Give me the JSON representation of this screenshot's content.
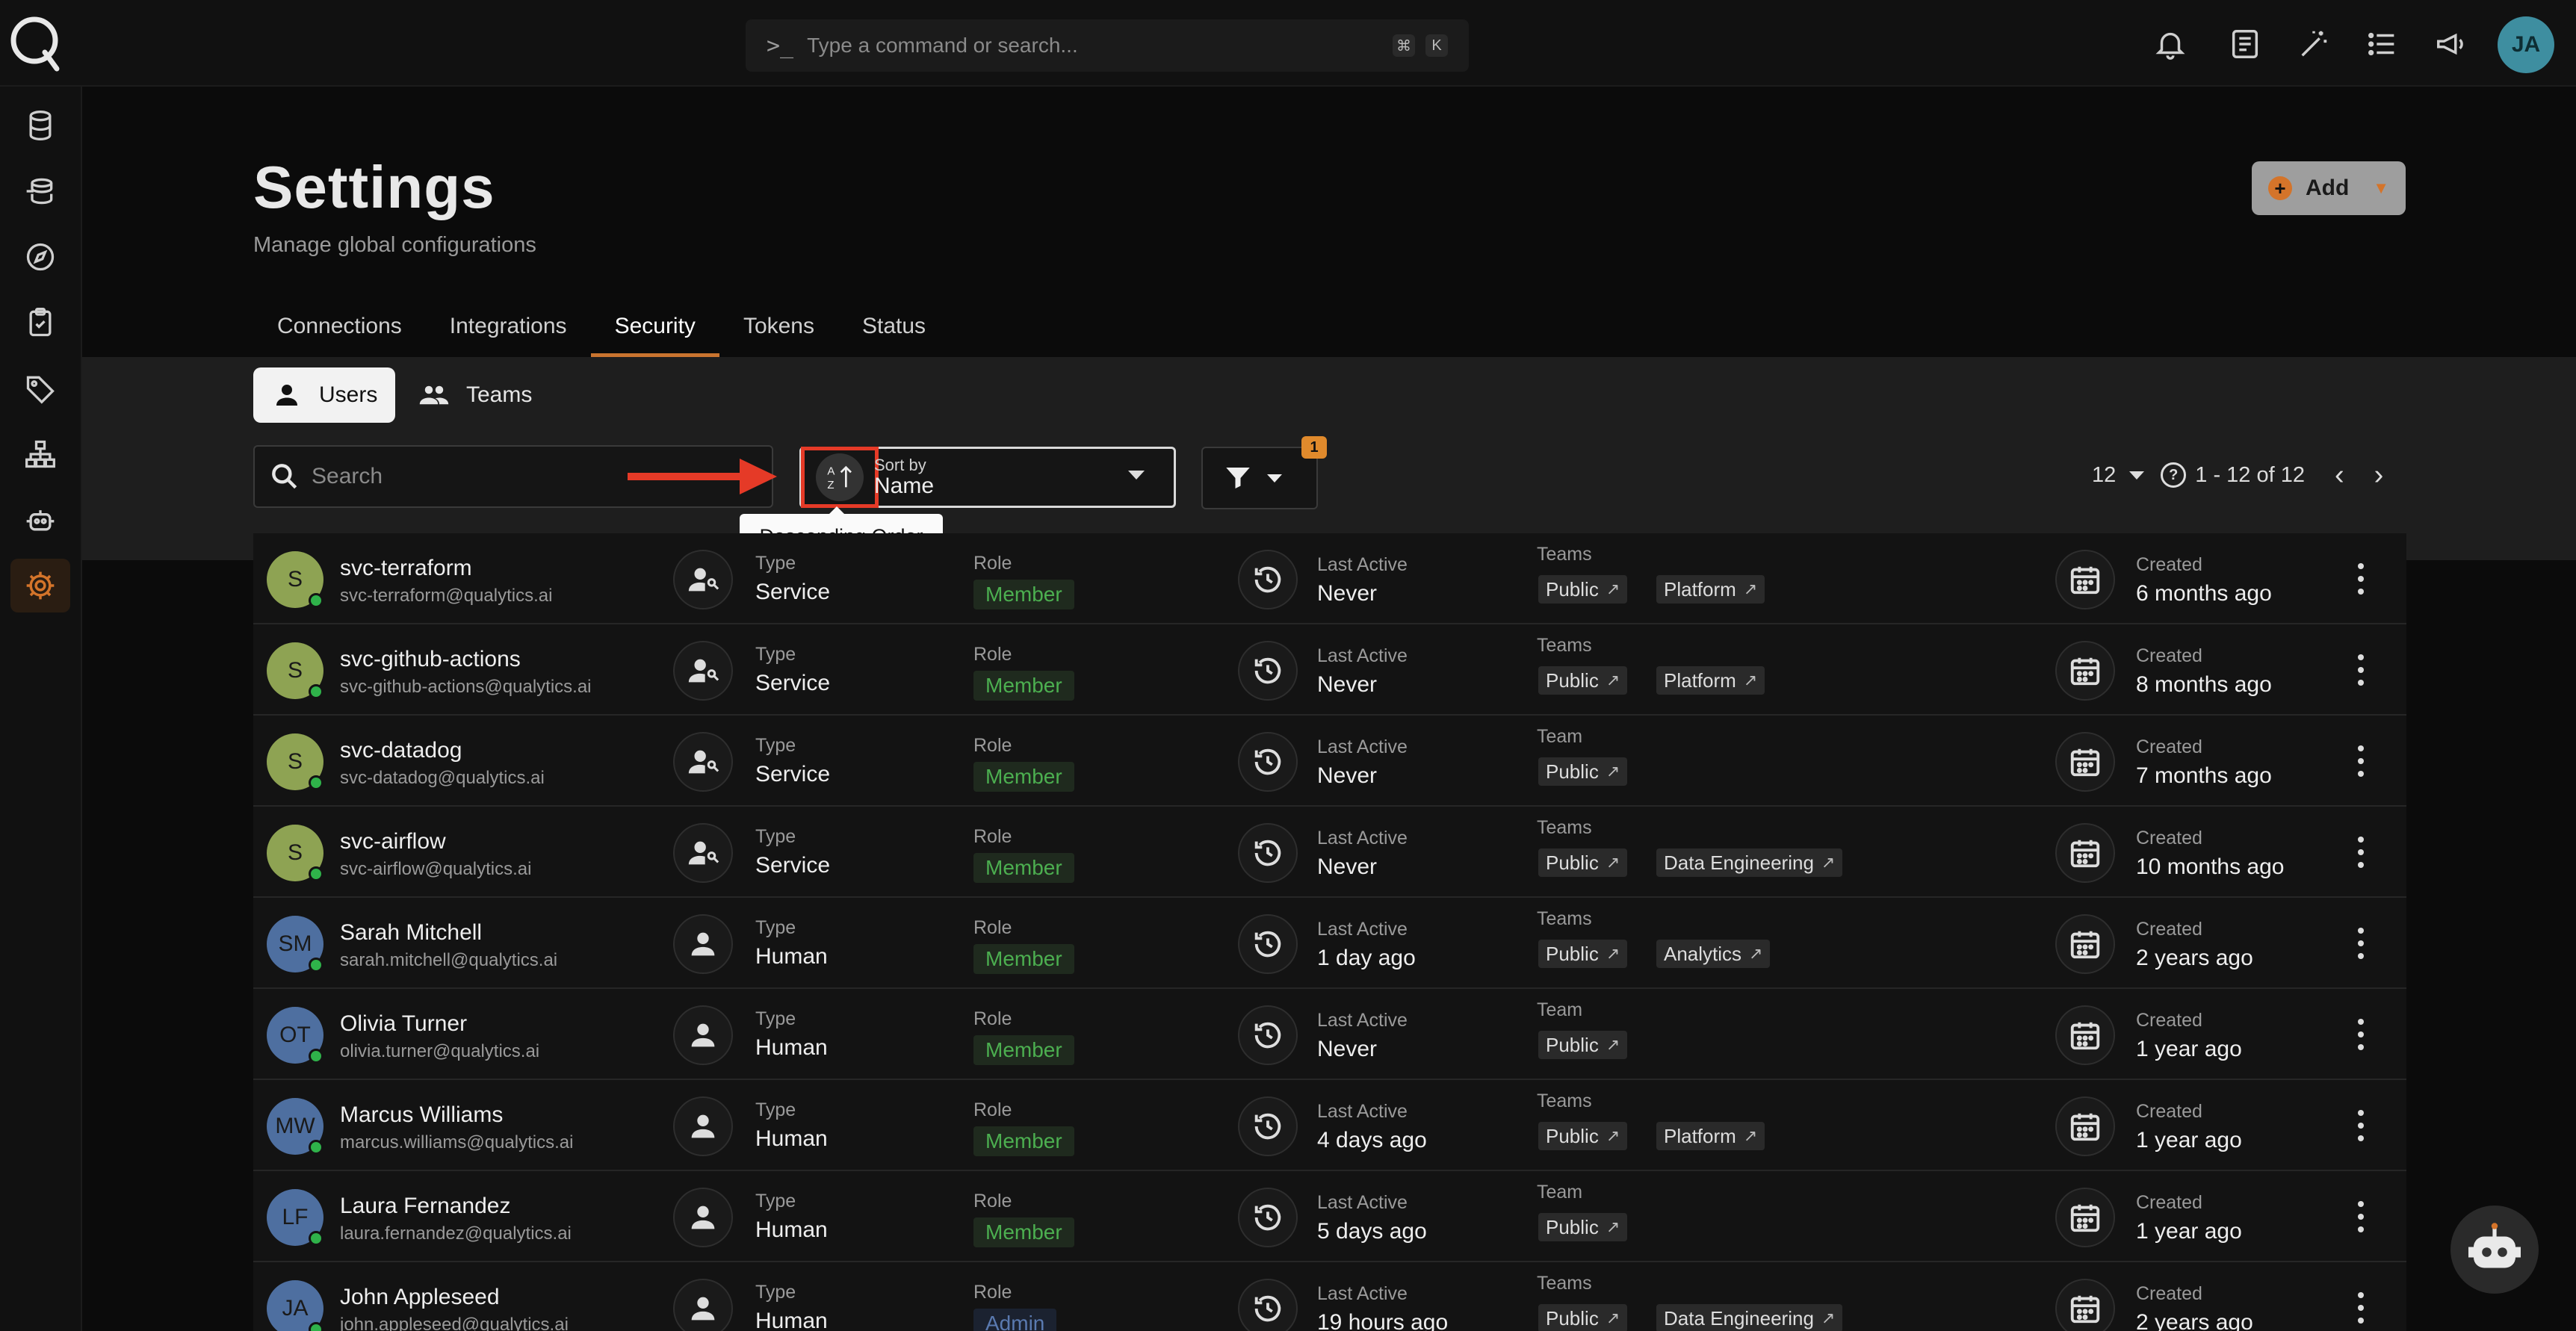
{
  "command": {
    "prompt": ">_",
    "placeholder": "Type a command or search...",
    "key1": "⌘",
    "key2": "K"
  },
  "user_initials": "JA",
  "page": {
    "title": "Settings",
    "subtitle": "Manage global configurations",
    "add_label": "Add"
  },
  "tabs": [
    "Connections",
    "Integrations",
    "Security",
    "Tokens",
    "Status"
  ],
  "active_tab": "Security",
  "segments": {
    "users": "Users",
    "teams": "Teams"
  },
  "search": {
    "placeholder": "Search"
  },
  "sort": {
    "label": "Sort by",
    "value": "Name",
    "tooltip": "Descending Order"
  },
  "filter": {
    "badge": "1"
  },
  "pager": {
    "per_page": "12",
    "range": "1 - 12 of 12"
  },
  "labels": {
    "type": "Type",
    "role": "Role",
    "last_active": "Last Active",
    "created": "Created"
  },
  "rows": [
    {
      "initials": "S",
      "avatar_color": "#8ea353",
      "name": "svc-terraform",
      "email": "svc-terraform@qualytics.ai",
      "type": "Service",
      "role": "Member",
      "last_active": "Never",
      "teams_label": "Teams",
      "teams": [
        "Public",
        "Platform"
      ],
      "created": "6 months ago"
    },
    {
      "initials": "S",
      "avatar_color": "#8ea353",
      "name": "svc-github-actions",
      "email": "svc-github-actions@qualytics.ai",
      "type": "Service",
      "role": "Member",
      "last_active": "Never",
      "teams_label": "Teams",
      "teams": [
        "Public",
        "Platform"
      ],
      "created": "8 months ago"
    },
    {
      "initials": "S",
      "avatar_color": "#8ea353",
      "name": "svc-datadog",
      "email": "svc-datadog@qualytics.ai",
      "type": "Service",
      "role": "Member",
      "last_active": "Never",
      "teams_label": "Team",
      "teams": [
        "Public"
      ],
      "created": "7 months ago"
    },
    {
      "initials": "S",
      "avatar_color": "#8ea353",
      "name": "svc-airflow",
      "email": "svc-airflow@qualytics.ai",
      "type": "Service",
      "role": "Member",
      "last_active": "Never",
      "teams_label": "Teams",
      "teams": [
        "Public",
        "Data Engineering"
      ],
      "created": "10 months ago"
    },
    {
      "initials": "SM",
      "avatar_color": "#4e6fa0",
      "name": "Sarah Mitchell",
      "email": "sarah.mitchell@qualytics.ai",
      "type": "Human",
      "role": "Member",
      "last_active": "1 day ago",
      "teams_label": "Teams",
      "teams": [
        "Public",
        "Analytics"
      ],
      "created": "2 years ago"
    },
    {
      "initials": "OT",
      "avatar_color": "#4e6fa0",
      "name": "Olivia Turner",
      "email": "olivia.turner@qualytics.ai",
      "type": "Human",
      "role": "Member",
      "last_active": "Never",
      "teams_label": "Team",
      "teams": [
        "Public"
      ],
      "created": "1 year ago"
    },
    {
      "initials": "MW",
      "avatar_color": "#4e6fa0",
      "name": "Marcus Williams",
      "email": "marcus.williams@qualytics.ai",
      "type": "Human",
      "role": "Member",
      "last_active": "4 days ago",
      "teams_label": "Teams",
      "teams": [
        "Public",
        "Platform"
      ],
      "created": "1 year ago"
    },
    {
      "initials": "LF",
      "avatar_color": "#4e6fa0",
      "name": "Laura Fernandez",
      "email": "laura.fernandez@qualytics.ai",
      "type": "Human",
      "role": "Member",
      "last_active": "5 days ago",
      "teams_label": "Team",
      "teams": [
        "Public"
      ],
      "created": "1 year ago"
    },
    {
      "initials": "JA",
      "avatar_color": "#4e6fa0",
      "name": "John Appleseed",
      "email": "john.appleseed@qualytics.ai",
      "type": "Human",
      "role": "Admin",
      "last_active": "19 hours ago",
      "teams_label": "Teams",
      "teams": [
        "Public",
        "Data Engineering"
      ],
      "created": "2 years ago"
    }
  ]
}
